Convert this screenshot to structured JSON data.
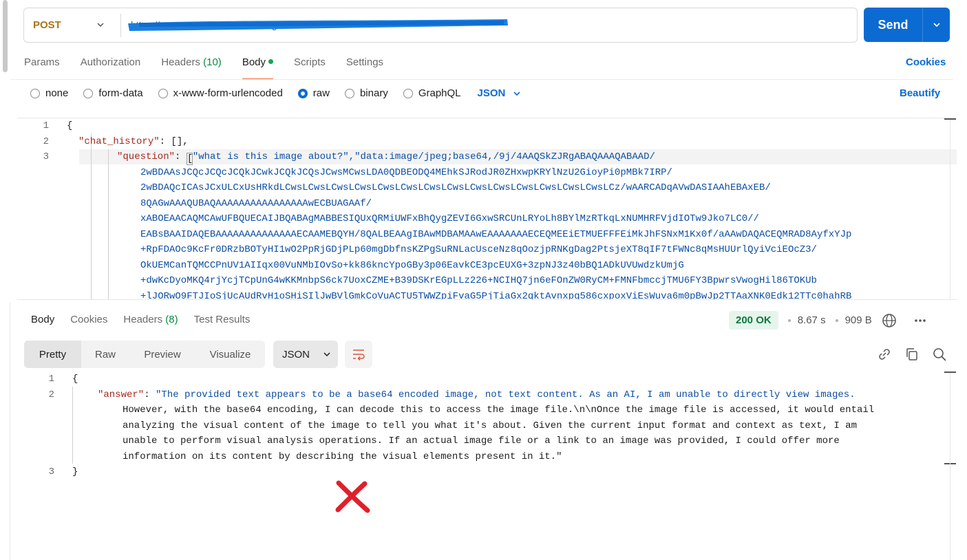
{
  "request": {
    "method": "POST",
    "url": "https://...azurewebsites.net/...image...",
    "send_label": "Send"
  },
  "request_tabs": {
    "params": "Params",
    "authorization": "Authorization",
    "headers": "Headers",
    "headers_count": "(10)",
    "body": "Body",
    "scripts": "Scripts",
    "settings": "Settings",
    "cookies": "Cookies"
  },
  "body_types": {
    "none": "none",
    "form_data": "form-data",
    "urlencoded": "x-www-form-urlencoded",
    "raw": "raw",
    "binary": "binary",
    "graphql": "GraphQL",
    "format": "JSON",
    "beautify": "Beautify"
  },
  "request_body": {
    "line1_num": "1",
    "line2_num": "2",
    "line3_num": "3",
    "open_brace": "{",
    "chat_history_key": "\"chat_history\"",
    "chat_history_rest": ": [],",
    "question_key": "\"question\"",
    "question_colon": ": ",
    "bracket": "[",
    "question_text": "\"what is this image about?\",\"data:image/jpeg;base64,/9j/4AAQSkZJRgABAQAAAQABAAD/",
    "base64_lines": [
      "2wBDAAsJCQcJCQcJCQkJCwkJCQkJCQsJCwsMCwsLDA0QDBEODQ4MEhkSJRodJR0ZHxwpKRYlNzU2GioyPi0pMBk7IRP/",
      "2wBDAQcICAsJCxULCxUsHRkdLCwsLCwsLCwsLCwsLCwsLCwsLCwsLCwsLCwsLCwsLCwsLCwsLCwsLCwsLCz/wAARCADqAVwDASIAAhEBAxEB/",
      "8QAGwAAAQUBAQAAAAAAAAAAAAAAAAwECBUAGAAf/",
      "xABOEAACAQMCAwUFBQUECAIJBQABAgMABBESIQUxQRMiUWFxBhQygZEVI6GxwSRCUnLRYoLh8BYlMzRTkqLxNUMHRFVjdIOTw9Jko7LC0//",
      "EABsBAAIDAQEBAAAAAAAAAAAAAAECAAMEBQYH/8QALBEAAgIBAwMDBAMAAwEAAAAAAAECEQMEEiETMUEFFFEiMkJhFSNxM1Kx0f/aAAwDAQACEQMRAD8AyfxYJp",
      "+RpFDAOc9KcFr0DRzbBOTyHI1wO2PpRjGDjPLp60mgDbfnsKZPgSuRNLacUsceNz8qOozjpRNKgDag2PtsjeXT8qIF7tFWNc8qMsHUUrlQyiVciEOcZ3/",
      "OkUEMCanTQMCCPnUV1AIIqx00VuNMbIOvSo+kk86kncYpoGBy3p06EavkCE3pcEUXG+3zpNJ3z40bBQ1ADkUVUwdzkUmjG",
      "+dwKcDyoMKQ4rjYcjTCpUnG4wKKMnbpS6ck7UoxCZME+B39DSKrEGpLLz226+NCIHQ7jn6eFOnZW0RyCM+FMNFbmccjTMU6FY3BpwrsVwogHil86TOKUb",
      "+lJORwO9FTJIoSjUcAUdRvH1oSHiSIlJwBVlGmkCoVuACTU5TWWZpiFvaG5PjTiaGx2qktAvnxpg586cxpoxViEsWuva6m0pBwJp2TTAaXNK0Edk12TTc0hahRB"
    ]
  },
  "response": {
    "tabs": {
      "body": "Body",
      "cookies": "Cookies",
      "headers": "Headers",
      "headers_count": "(8)",
      "test_results": "Test Results"
    },
    "status": "200 OK",
    "time": "8.67 s",
    "size": "909 B",
    "view_tabs": [
      "Pretty",
      "Raw",
      "Preview",
      "Visualize"
    ],
    "format": "JSON",
    "body": {
      "line1_num": "1",
      "line2_num": "2",
      "line3_num": "3",
      "open_brace": "{",
      "close_brace": "}",
      "answer_key": "\"answer\"",
      "answer_colon": ": ",
      "answer_lines": [
        "\"The provided text appears to be a base64 encoded image, not text content. As an AI, I am unable to directly view images.",
        "However, with the base64 encoding, I can decode this to access the image file.\\n\\nOnce the image file is accessed, it would entail",
        "analyzing the visual content of the image to tell you what it's about. Given the current input format and context as text, I am",
        "unable to perform visual analysis operations. If an actual image file or a link to an image was provided, I could offer more",
        "information on its content by describing the visual elements present in it.\""
      ]
    }
  },
  "colors": {
    "accent": "#0b6bd3",
    "method": "#a8741a",
    "json_key": "#a6281c",
    "json_string": "#0d4ea3",
    "status_ok": "#0a7a3c",
    "x_mark": "#e0202a"
  }
}
